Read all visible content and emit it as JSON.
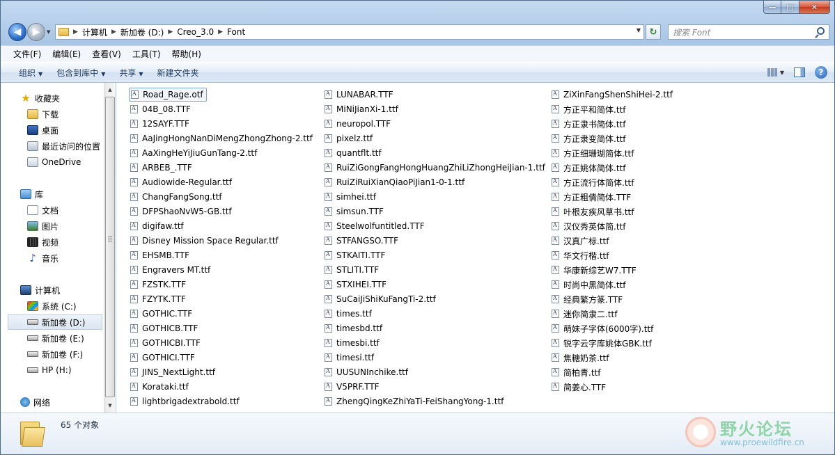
{
  "window": {
    "caption": {
      "minimize": "—",
      "maximize": "□",
      "close": "✕"
    }
  },
  "address": {
    "crumbs": [
      "计算机",
      "新加卷 (D:)",
      "Creo_3.0",
      "Font"
    ],
    "search_placeholder": "搜索 Font"
  },
  "menu": [
    "文件(F)",
    "编辑(E)",
    "查看(V)",
    "工具(T)",
    "帮助(H)"
  ],
  "toolbar": [
    "组织",
    "包含到库中",
    "共享",
    "新建文件夹"
  ],
  "nav": [
    {
      "label": "收藏夹",
      "icon": "star-icon"
    },
    {
      "label": "下载",
      "icon": "download-folder-icon"
    },
    {
      "label": "桌面",
      "icon": "desktop-icon"
    },
    {
      "label": "最近访问的位置",
      "icon": "recent-places-icon"
    },
    {
      "label": "OneDrive",
      "icon": "onedrive-icon"
    },
    {
      "label": "库",
      "icon": "library-icon"
    },
    {
      "label": "文档",
      "icon": "documents-icon"
    },
    {
      "label": "图片",
      "icon": "pictures-icon"
    },
    {
      "label": "视频",
      "icon": "videos-icon"
    },
    {
      "label": "音乐",
      "icon": "music-icon"
    },
    {
      "label": "计算机",
      "icon": "computer-icon"
    },
    {
      "label": "系统 (C:)",
      "icon": "system-drive-icon"
    },
    {
      "label": "新加卷 (D:)",
      "icon": "drive-icon"
    },
    {
      "label": "新加卷 (E:)",
      "icon": "drive-icon"
    },
    {
      "label": "新加卷 (F:)",
      "icon": "drive-icon"
    },
    {
      "label": "HP (H:)",
      "icon": "drive-icon"
    },
    {
      "label": "网络",
      "icon": "network-icon"
    }
  ],
  "files": [
    [
      "Road_Rage.otf",
      "04B_08.TTF",
      "12SAYF.TTF",
      "AaJingHongNanDiMengZhongZhong-2.ttf",
      "AaXingHeYiJiuGunTang-2.ttf",
      "ARBEB_.TTF",
      "Audiowide-Regular.ttf",
      "ChangFangSong.ttf",
      "DFPShaoNvW5-GB.ttf",
      "digifaw.ttf",
      "Disney Mission Space Regular.ttf",
      "EHSMB.TTF",
      "Engravers MT.ttf",
      "FZSTK.TTF",
      "FZYTK.TTF",
      "GOTHIC.TTF",
      "GOTHICB.TTF",
      "GOTHICBI.TTF",
      "GOTHICI.TTF",
      "JINS_NextLight.ttf",
      "Korataki.ttf",
      "lightbrigadextrabold.ttf"
    ],
    [
      "LUNABAR.TTF",
      "MiNiJianXi-1.ttf",
      "neuropol.TTF",
      "pixelz.ttf",
      "quantflt.ttf",
      "RuiZiGongFangHongHuangZhiLiZhongHeiJian-1.ttf",
      "RuiZiRuiXianQiaoPiJian1-0-1.ttf",
      "simhei.ttf",
      "simsun.TTF",
      "Steelwolfuntitled.TTF",
      "STFANGSO.TTF",
      "STKAITI.TTF",
      "STLITI.TTF",
      "STXIHEI.TTF",
      "SuCaiJiShiKuFangTi-2.ttf",
      "times.ttf",
      "timesbd.ttf",
      "timesbi.ttf",
      "timesi.ttf",
      "UUSUNInchike.ttf",
      "V5PRF.TTF",
      "ZhengQingKeZhiYaTi-FeiShangYong-1.ttf"
    ],
    [
      "ZiXinFangShenShiHei-2.ttf",
      "方正平和简体.ttf",
      "方正隶书简体.ttf",
      "方正隶变简体.ttf",
      "方正细珊瑚简体.ttf",
      "方正姚体简体.ttf",
      "方正流行体简体.ttf",
      "方正粗倩简体.TTF",
      "叶根友疾风草书.ttf",
      "汉仪秀英体简.ttf",
      "汉真广标.ttf",
      "华文行楷.ttf",
      "华康新综艺W7.TTF",
      "时尚中黑简体.ttf",
      "经典繁方篆.TTF",
      "迷你简隶二.ttf",
      "萌妹子字体(6000字).ttf",
      "锐字云字库姚体GBK.ttf",
      "焦糖奶茶.ttf",
      "简柏青.ttf",
      "简姜心.TTF"
    ]
  ],
  "status": {
    "count": "65 个对象"
  },
  "watermark": {
    "title": "野火论坛",
    "url": "www.proewildfire.cn"
  }
}
